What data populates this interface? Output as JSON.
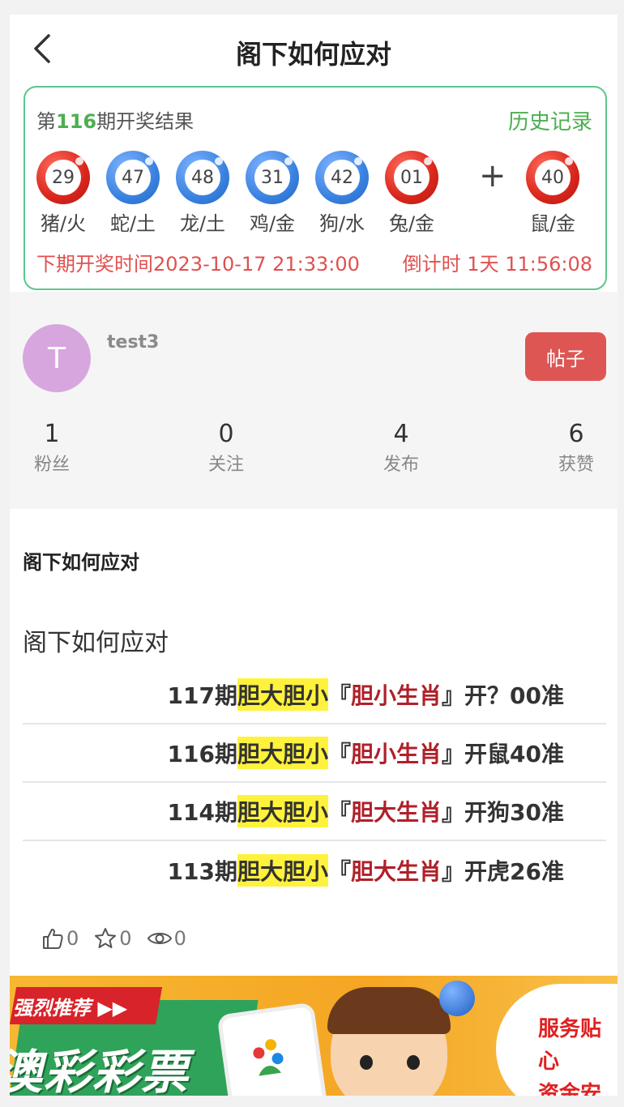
{
  "header": {
    "title": "阁下如何应对"
  },
  "lottery": {
    "issue_prefix": "第",
    "issue_number": "116",
    "issue_suffix": "期开奖结果",
    "history_label": "历史记录",
    "balls": [
      {
        "number": "29",
        "label": "猪/火",
        "color": "red"
      },
      {
        "number": "47",
        "label": "蛇/土",
        "color": "blue"
      },
      {
        "number": "48",
        "label": "龙/土",
        "color": "blue"
      },
      {
        "number": "31",
        "label": "鸡/金",
        "color": "blue"
      },
      {
        "number": "42",
        "label": "狗/水",
        "color": "blue"
      },
      {
        "number": "01",
        "label": "兔/金",
        "color": "red"
      }
    ],
    "plus": "+",
    "special_ball": {
      "number": "40",
      "label": "鼠/金",
      "color": "red"
    },
    "next_draw": "下期开奖时间2023-10-17 21:33:00",
    "countdown": "倒计时 1天 11:56:08"
  },
  "profile": {
    "avatar_letter": "T",
    "username": "test3",
    "posts_button": "帖子",
    "stats": [
      {
        "value": "1",
        "label": "粉丝"
      },
      {
        "value": "0",
        "label": "关注"
      },
      {
        "value": "4",
        "label": "发布"
      },
      {
        "value": "6",
        "label": "获赞"
      }
    ]
  },
  "post": {
    "heading": "阁下如何应对",
    "body": "阁下如何应对",
    "predictions": [
      {
        "period": "117期",
        "tag": "胆大胆小",
        "open_bracket": "『",
        "pick": "胆小生肖",
        "close_bracket": "』",
        "result": "开？00准"
      },
      {
        "period": "116期",
        "tag": "胆大胆小",
        "open_bracket": "『",
        "pick": "胆小生肖",
        "close_bracket": "』",
        "result": "开鼠40准"
      },
      {
        "period": "114期",
        "tag": "胆大胆小",
        "open_bracket": "『",
        "pick": "胆大生肖",
        "close_bracket": "』",
        "result": "开狗30准"
      },
      {
        "period": "113期",
        "tag": "胆大胆小",
        "open_bracket": "『",
        "pick": "胆大生肖",
        "close_bracket": "』",
        "result": "开虎26准"
      }
    ],
    "actions": {
      "likes": "0",
      "favorites": "0",
      "views": "0"
    }
  },
  "banner": {
    "ribbon": "强烈推荐 ▶▶",
    "big_text": "澳彩彩票",
    "side_lines": [
      "服务贴心",
      "资金安全"
    ]
  },
  "colors": {
    "accent_green": "#4caf50",
    "border_green": "#5cc68a",
    "danger_red": "#e05050",
    "button_red": "#dd5653",
    "ball_red": "#d9261c",
    "ball_blue": "#3a82e0",
    "highlight_yellow": "#fff23c",
    "avatar": "#d8a6df"
  },
  "icons": {
    "back": "chevron-left-icon",
    "like": "thumbs-up-icon",
    "favorite": "star-icon",
    "views": "eye-icon"
  }
}
